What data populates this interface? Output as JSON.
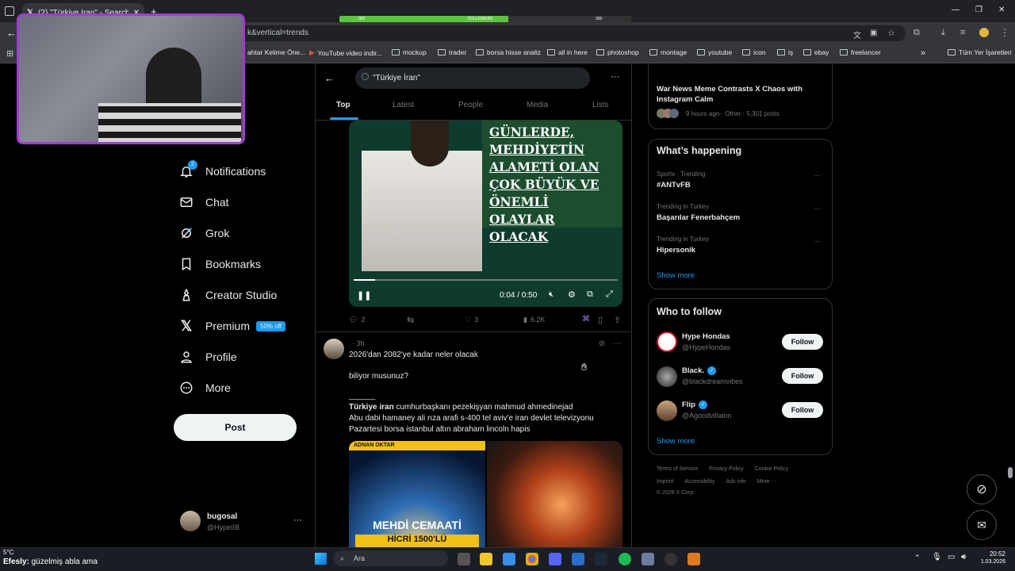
{
  "browser": {
    "tab_title": "(2) \"Türkiye İran\" - Search / X",
    "url": "k&vertical=trends",
    "bookmarks": [
      "ahtar Kelime Öne...",
      "YouTube video indir...",
      "mockup",
      "trader",
      "borsa hisse analiz",
      "all in here",
      "photoshop",
      "montage",
      "youtube",
      "icon",
      "iş",
      "ebay",
      "freelancer"
    ],
    "all_bookmarks": "Tüm Yer İşaretleri"
  },
  "overlay": {
    "followers_label": "FOLLOWERS",
    "followers_current": "362",
    "followers_goal": "300",
    "followers_progress": 0.58,
    "chat_user": "Efesly:",
    "chat_message": "güzelmiş abla ama",
    "weather": "5°C"
  },
  "nav": {
    "notifications": "Notifications",
    "notif_badge": "2",
    "chat": "Chat",
    "grok": "Grok",
    "bookmarks": "Bookmarks",
    "creator": "Creator Studio",
    "premium": "Premium",
    "premium_badge": "50% off",
    "profile": "Profile",
    "more": "More",
    "post": "Post"
  },
  "account": {
    "name": "bugosal",
    "handle": "@HypeIIB"
  },
  "search": {
    "query": "\"Türkiye İran\"",
    "tabs": [
      "Top",
      "Latest",
      "People",
      "Media",
      "Lists"
    ]
  },
  "post1": {
    "video_text": "GÜNLERDE, MEHDİYETİN ALAMETİ OLAN ÇOK BÜYÜK VE ÖNEMLİ OLAYLAR OLACAK",
    "time": "0:04 / 0:50",
    "replies": "2",
    "likes": "3",
    "views": "6.2K"
  },
  "post2": {
    "age": "· 3h",
    "line1": "2026'dan 2082'ye kadar neler olacak",
    "line2": "biliyor musunuz?",
    "line3": "______",
    "bold": "Türkiye iran",
    "line4": " cumhurbaşkanı pezekişyan mahmud ahmedinejad",
    "line5": "Abu dabi hamaney ali rıza arafi s-400 tel aviv'e iran devlet televizyonu",
    "line6": "Pazartesi borsa istanbul altın abraham lincoln hapis",
    "img1_top": "ADNAN OKTAR",
    "img1_text": "MEHDİ CEMAATİ",
    "img1_text2": "HİCRİ 1500'LÜ"
  },
  "news": {
    "title": "War News Meme Contrasts X Chaos with Instagram Calm",
    "meta": "9 hours ago · Other · 5,301 posts"
  },
  "happening": {
    "title": "What’s happening",
    "items": [
      {
        "ctx": "Sports · Trending",
        "name": "#ANTvFB"
      },
      {
        "ctx": "Trending in Turkey",
        "name": "Başarılar Fenerbahçem"
      },
      {
        "ctx": "Trending in Turkey",
        "name": "Hipersonik"
      }
    ],
    "show_more": "Show more"
  },
  "follow": {
    "title": "Who to follow",
    "items": [
      {
        "name": "Hype Hondas",
        "handle": "@HypeHondas",
        "btn": "Follow"
      },
      {
        "name": "Black.",
        "handle": "@blackdreamvibes",
        "btn": "Follow"
      },
      {
        "name": "Flip",
        "handle": "@Agoodvillainn",
        "btn": "Follow"
      }
    ],
    "show_more": "Show more"
  },
  "footer": {
    "line1": [
      "Terms of Service",
      "Privacy Policy",
      "Cookie Policy"
    ],
    "line2": [
      "Imprint",
      "Accessibility",
      "Ads info",
      "More ···"
    ],
    "copy": "© 2026 X Corp."
  },
  "taskbar": {
    "search": "Ara",
    "time": "20:52",
    "date": "1.03.2026"
  },
  "colors": {
    "accent": "#1d9bf0",
    "bg": "#000000",
    "overlay_purple": "#a23bd6"
  }
}
